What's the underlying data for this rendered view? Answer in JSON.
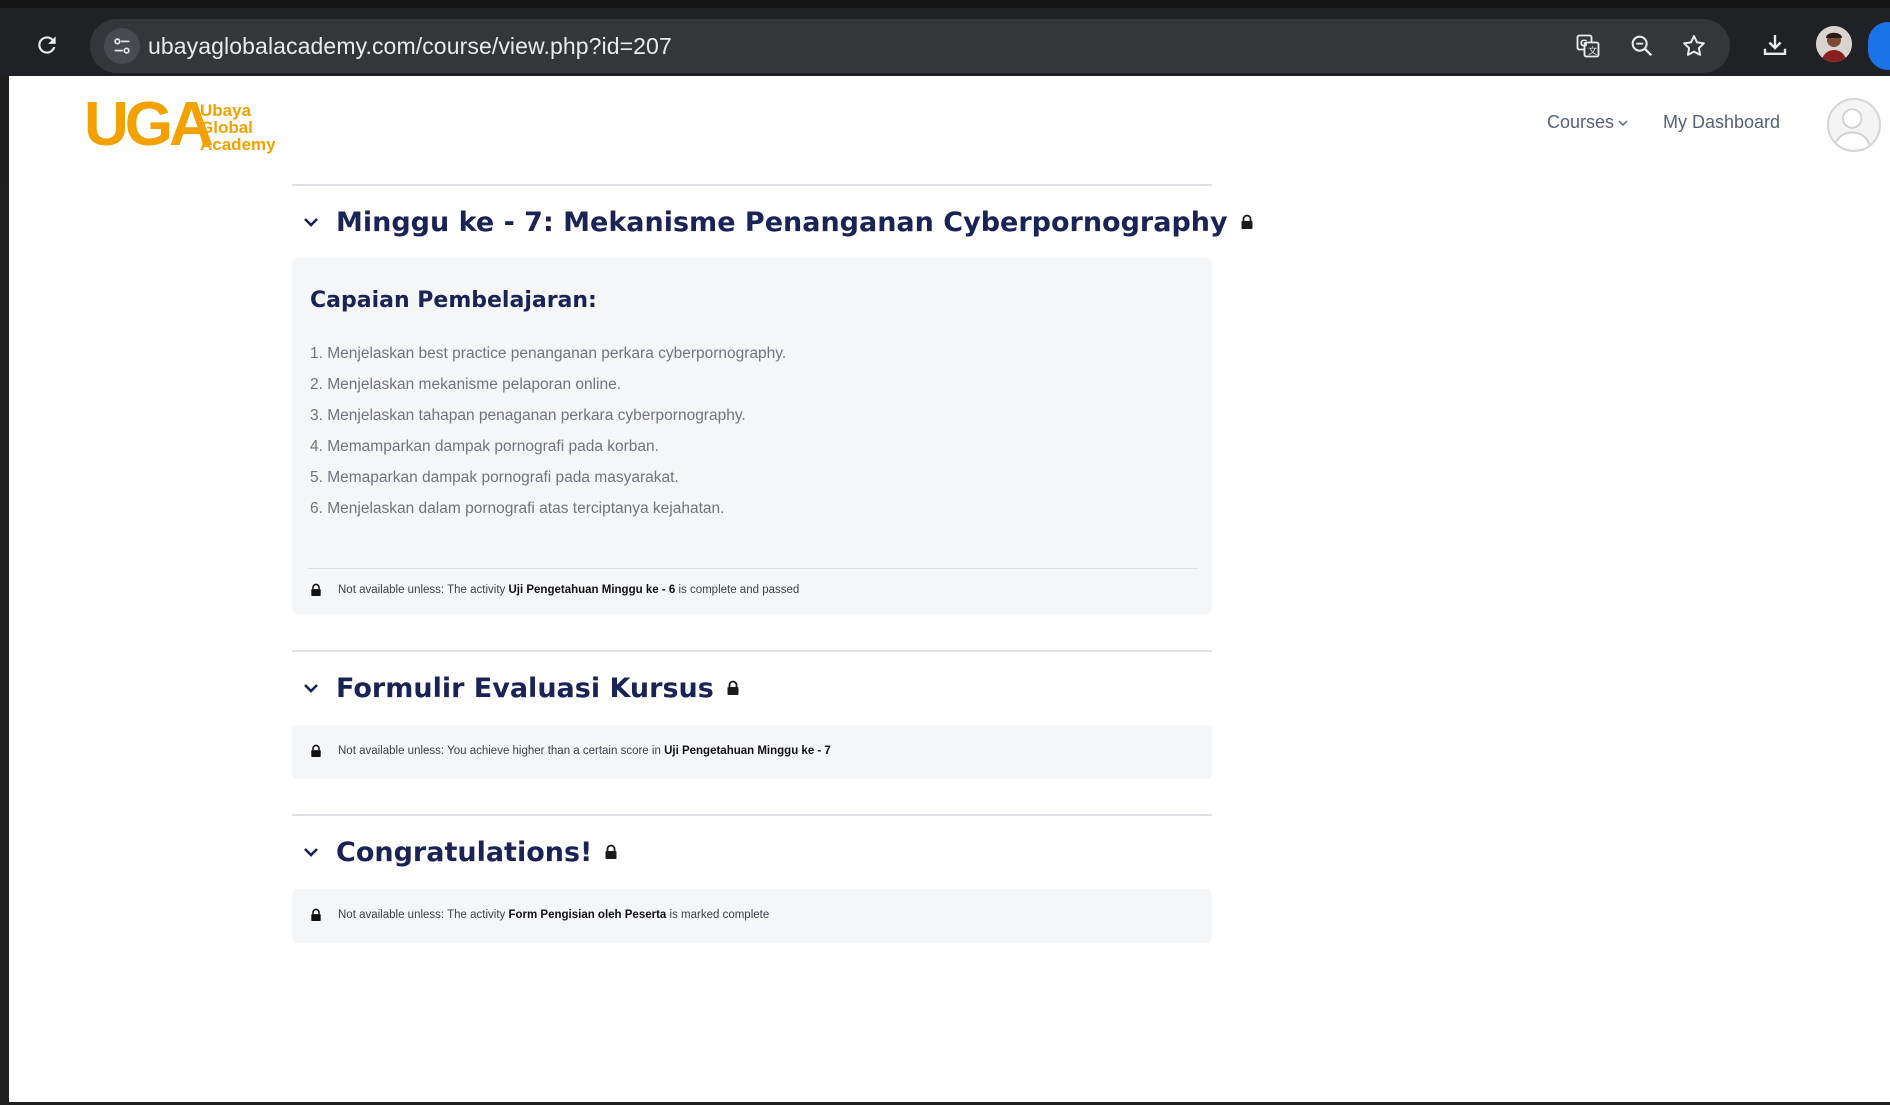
{
  "browser": {
    "url": "ubayaglobalacademy.com/course/view.php?id=207"
  },
  "site": {
    "logo_mark": "UGA",
    "logo_lines": [
      "Ubaya",
      "Global",
      "Academy"
    ],
    "nav_courses": "Courses",
    "nav_dashboard": "My Dashboard"
  },
  "sections": [
    {
      "title": "Minggu ke - 7: Mekanisme Penanganan Cyberpornography",
      "summary_title": "Capaian Pembelajaran:",
      "objectives": [
        "1. Menjelaskan best practice penanganan perkara cyberpornography.",
        "2. Menjelaskan mekanisme pelaporan online.",
        "3. Menjelaskan tahapan penaganan perkara cyberpornography.",
        "4. Memamparkan dampak pornografi pada korban.",
        "5. Memaparkan dampak pornografi pada masyarakat.",
        "6. Menjelaskan dalam pornografi atas terciptanya kejahatan."
      ],
      "restriction_prefix": "Not available unless: The activity ",
      "restriction_item": "Uji Pengetahuan Minggu ke - 6",
      "restriction_suffix": " is complete and passed"
    },
    {
      "title": "Formulir Evaluasi Kursus",
      "restriction_prefix": "Not available unless: You achieve higher than a certain score in ",
      "restriction_item": "Uji Pengetahuan Minggu ke - 7",
      "restriction_suffix": ""
    },
    {
      "title": "Congratulations!",
      "restriction_prefix": "Not available unless: The activity ",
      "restriction_item": "Form Pengisian oleh Peserta",
      "restriction_suffix": " is marked complete"
    }
  ],
  "colors": {
    "brand": "#f2a100",
    "heading": "#1a2356",
    "chrome_bg": "#202124"
  },
  "icons": {
    "reload": "reload-icon",
    "site_info": "tune-icon",
    "translate": "translate-icon",
    "zoom": "zoom-icon",
    "bookmark": "star-icon",
    "download": "download-icon",
    "lock": "lock-icon",
    "chevron": "chevron-down-icon"
  }
}
